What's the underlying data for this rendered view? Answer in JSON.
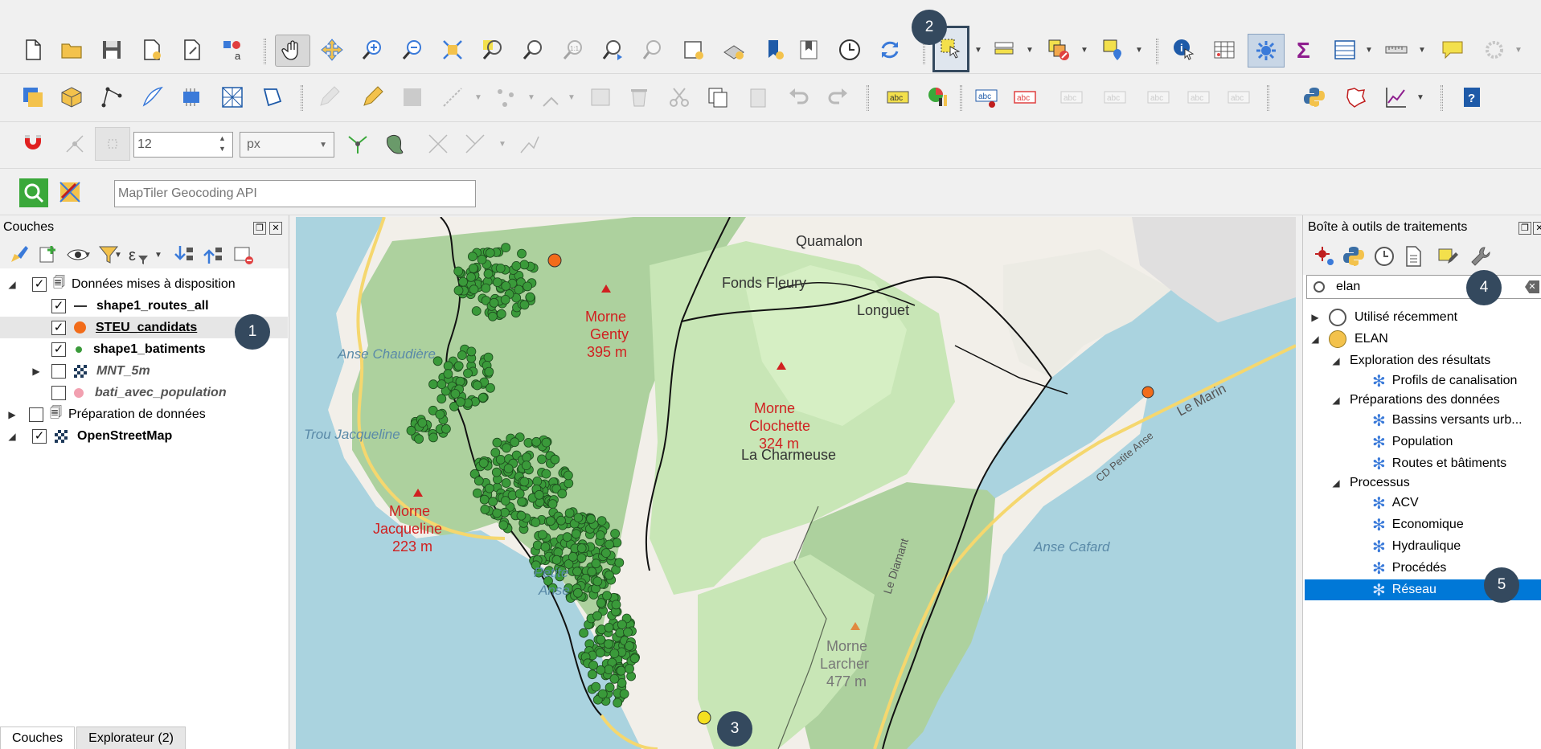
{
  "toolbar_snap": {
    "tolerance_value": "12",
    "unit_value": "px"
  },
  "toolbar_search": {
    "placeholder": "MapTiler Geocoding API"
  },
  "layers_panel": {
    "title": "Couches",
    "items": [
      {
        "label": "Données mises à disposition",
        "checked": true,
        "expanded": true
      },
      {
        "label": "shape1_routes_all",
        "checked": true
      },
      {
        "label": "STEU_candidats",
        "checked": true
      },
      {
        "label": "shape1_batiments",
        "checked": true
      },
      {
        "label": "MNT_5m",
        "checked": false
      },
      {
        "label": "bati_avec_population",
        "checked": false
      },
      {
        "label": "Préparation de données",
        "checked": false,
        "expanded": false
      },
      {
        "label": "OpenStreetMap",
        "checked": true,
        "expanded": true
      }
    ],
    "tabs": [
      "Couches",
      "Explorateur (2)"
    ]
  },
  "processing_panel": {
    "title": "Boîte à outils de traitements",
    "search_value": "elan",
    "tree": [
      {
        "label": "Utilisé récemment",
        "level": 0
      },
      {
        "label": "ELAN",
        "level": 0
      },
      {
        "label": "Exploration des résultats",
        "level": 1
      },
      {
        "label": "Profils de canalisation",
        "level": 2
      },
      {
        "label": "Préparations des données",
        "level": 1
      },
      {
        "label": "Bassins versants urb...",
        "level": 2
      },
      {
        "label": "Population",
        "level": 2
      },
      {
        "label": "Routes et bâtiments",
        "level": 2
      },
      {
        "label": "Processus",
        "level": 1
      },
      {
        "label": "ACV",
        "level": 2
      },
      {
        "label": "Economique",
        "level": 2
      },
      {
        "label": "Hydraulique",
        "level": 2
      },
      {
        "label": "Procédés",
        "level": 2
      },
      {
        "label": "Réseau",
        "level": 2,
        "selected": true
      }
    ]
  },
  "map": {
    "labels": {
      "quamalon": "Quamalon",
      "fonds_fleury": "Fonds Fleury",
      "longuet": "Longuet",
      "morne_genty": "Morne",
      "morne_genty_2": "Genty",
      "morne_genty_alt": "395 m",
      "anse_chaudiere": "Anse Chaudière",
      "morne_clochette": "Morne",
      "morne_clochette_2": "Clochette",
      "morne_clochette_alt": "324 m",
      "trou_jacqueline": "Trou Jacqueline",
      "la_charmeuse": "La Charmeuse",
      "le_marin": "Le Marin",
      "cd_petite_anse": "CD Petite Anse",
      "morne_jacqueline": "Morne",
      "morne_jacqueline_2": "Jacqueline",
      "morne_jacqueline_alt": "223 m",
      "anse_cafard": "Anse Cafard",
      "petite_anse": "Petite",
      "petite_anse_2": "Anse",
      "le_diamant": "Le Diamant",
      "morne_larcher": "Morne",
      "morne_larcher_2": "Larcher",
      "morne_larcher_alt": "477 m"
    }
  },
  "badges": [
    "1",
    "2",
    "3",
    "4",
    "5"
  ],
  "colors": {
    "accent": "#0078d7",
    "badge": "#34495e",
    "building": "#3a9a3a",
    "steu": "#f26c1a"
  }
}
